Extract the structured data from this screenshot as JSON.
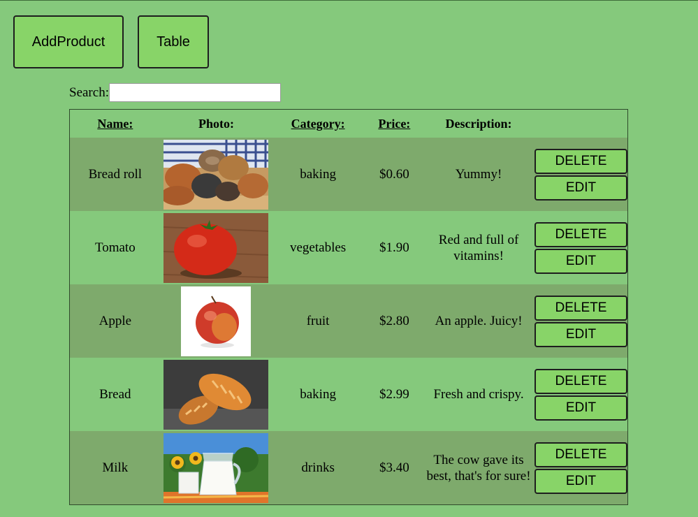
{
  "nav": {
    "add_label": "AddProduct",
    "table_label": "Table"
  },
  "search": {
    "label": "Search:",
    "value": "",
    "placeholder": ""
  },
  "table": {
    "headers": {
      "name": "Name:",
      "photo": "Photo:",
      "category": "Category:",
      "price": "Price:",
      "description": "Description:"
    },
    "rows": [
      {
        "name": "Bread roll",
        "photo": "bread-rolls-photo",
        "category": "baking",
        "price": "$0.60",
        "description": "Yummy!",
        "delete_label": "DELETE",
        "edit_label": "EDIT"
      },
      {
        "name": "Tomato",
        "photo": "tomato-photo",
        "category": "vegetables",
        "price": "$1.90",
        "description": "Red and full of vitamins!",
        "delete_label": "DELETE",
        "edit_label": "EDIT"
      },
      {
        "name": "Apple",
        "photo": "apple-photo",
        "category": "fruit",
        "price": "$2.80",
        "description": "An apple. Juicy!",
        "delete_label": "DELETE",
        "edit_label": "EDIT"
      },
      {
        "name": "Bread",
        "photo": "bread-loaves-photo",
        "category": "baking",
        "price": "$2.99",
        "description": "Fresh and crispy.",
        "delete_label": "DELETE",
        "edit_label": "EDIT"
      },
      {
        "name": "Milk",
        "photo": "milk-jug-photo",
        "category": "drinks",
        "price": "$3.40",
        "description": "The cow gave its best, that's for sure!",
        "delete_label": "DELETE",
        "edit_label": "EDIT"
      }
    ]
  },
  "colors": {
    "background": "#85c97c",
    "row_shade": "#7eaa6c",
    "button": "#88d468"
  }
}
